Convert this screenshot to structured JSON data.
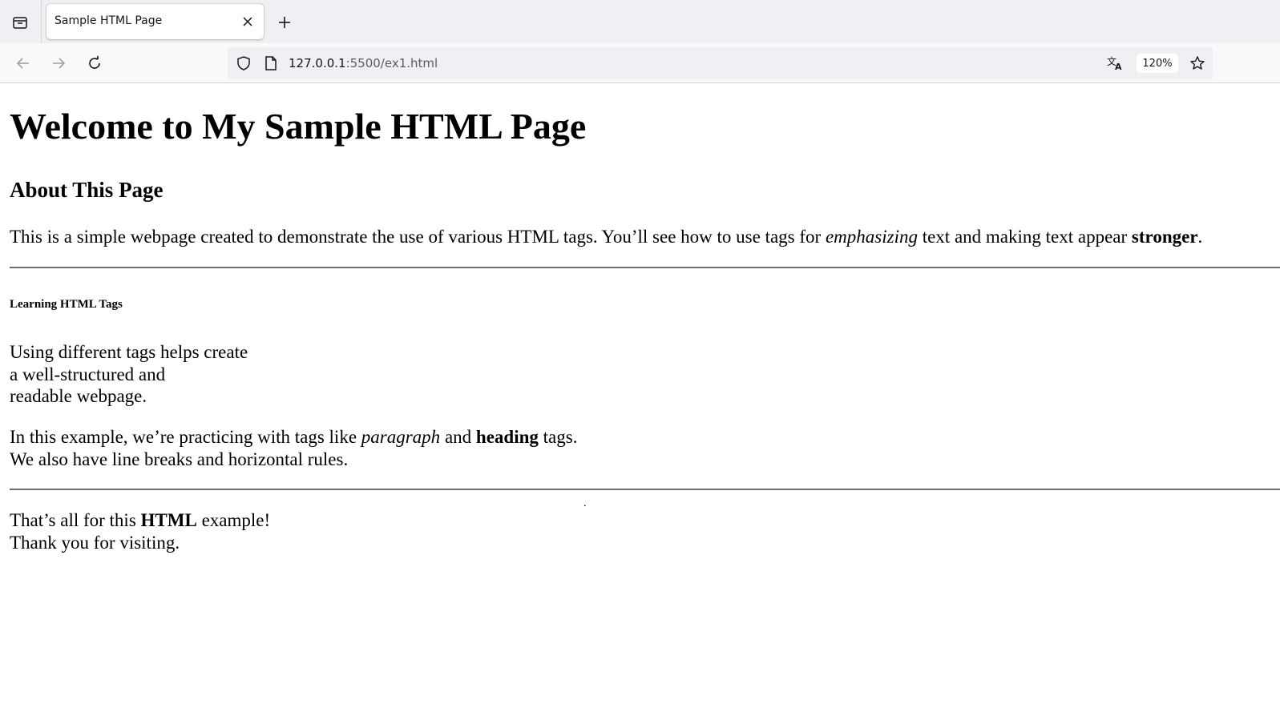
{
  "browser": {
    "tab": {
      "title": "Sample HTML Page"
    },
    "url": {
      "host": "127.0.0.1",
      "path": ":5500/ex1.html"
    },
    "zoom": "120%",
    "icons": {
      "tab_list": "tab-list-icon",
      "close_tab": "close-icon",
      "new_tab": "plus-icon",
      "back": "arrow-left-icon",
      "forward": "arrow-right-icon",
      "reload": "reload-icon",
      "site_info": "shield-icon",
      "page": "page-icon",
      "translate": "translate-icon",
      "bookmark": "star-icon"
    }
  },
  "page": {
    "h1": "Welcome to My Sample HTML Page",
    "h2": "About This Page",
    "intro": {
      "part1": "This is a simple webpage created to demonstrate the use of various HTML tags. You’ll see how to use tags for ",
      "em": "emphasizing",
      "part2": " text and making text appear ",
      "strong": "stronger",
      "part3": "."
    },
    "h6": "Learning HTML Tags",
    "structure_lines": [
      "Using different tags helps create",
      "a well-structured and",
      "readable webpage."
    ],
    "practice": {
      "part1": "In this example, we’re practicing with tags like ",
      "em": "paragraph",
      "part2": " and ",
      "strong": "heading",
      "part3": " tags.",
      "line2": "We also have line breaks and horizontal rules."
    },
    "stray_mark": ".",
    "closing": {
      "part1": "That’s all for this ",
      "strong": "HTML",
      "part2": " example!",
      "line2": "Thank you for visiting."
    }
  }
}
